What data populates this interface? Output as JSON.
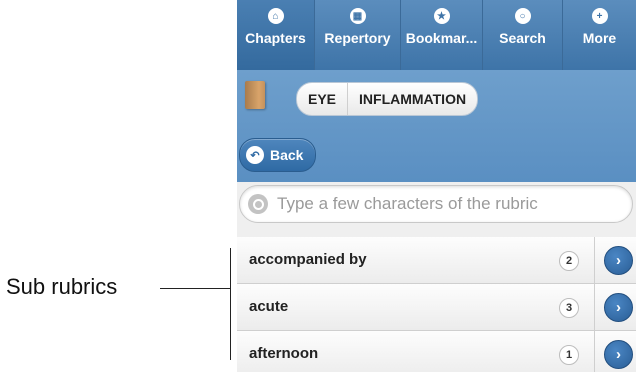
{
  "annotation": {
    "label": "Sub rubrics"
  },
  "tabs": [
    {
      "label": "Chapters",
      "icon": "home-icon",
      "active": true
    },
    {
      "label": "Repertory",
      "icon": "grid-icon"
    },
    {
      "label": "Bookmar...",
      "icon": "star-icon"
    },
    {
      "label": "Search",
      "icon": "search-icon"
    },
    {
      "label": "More",
      "icon": "plus-icon"
    }
  ],
  "header": {
    "breadcrumb": [
      "EYE",
      "INFLAMMATION"
    ],
    "back_label": "Back"
  },
  "search": {
    "placeholder": "Type a few characters of the rubric",
    "value": ""
  },
  "rubrics": [
    {
      "label": "accompanied by",
      "count": "2"
    },
    {
      "label": "acute",
      "count": "3"
    },
    {
      "label": "afternoon",
      "count": "1"
    }
  ],
  "colors": {
    "accent": "#3e74a8",
    "header": "#6e9fcc"
  }
}
